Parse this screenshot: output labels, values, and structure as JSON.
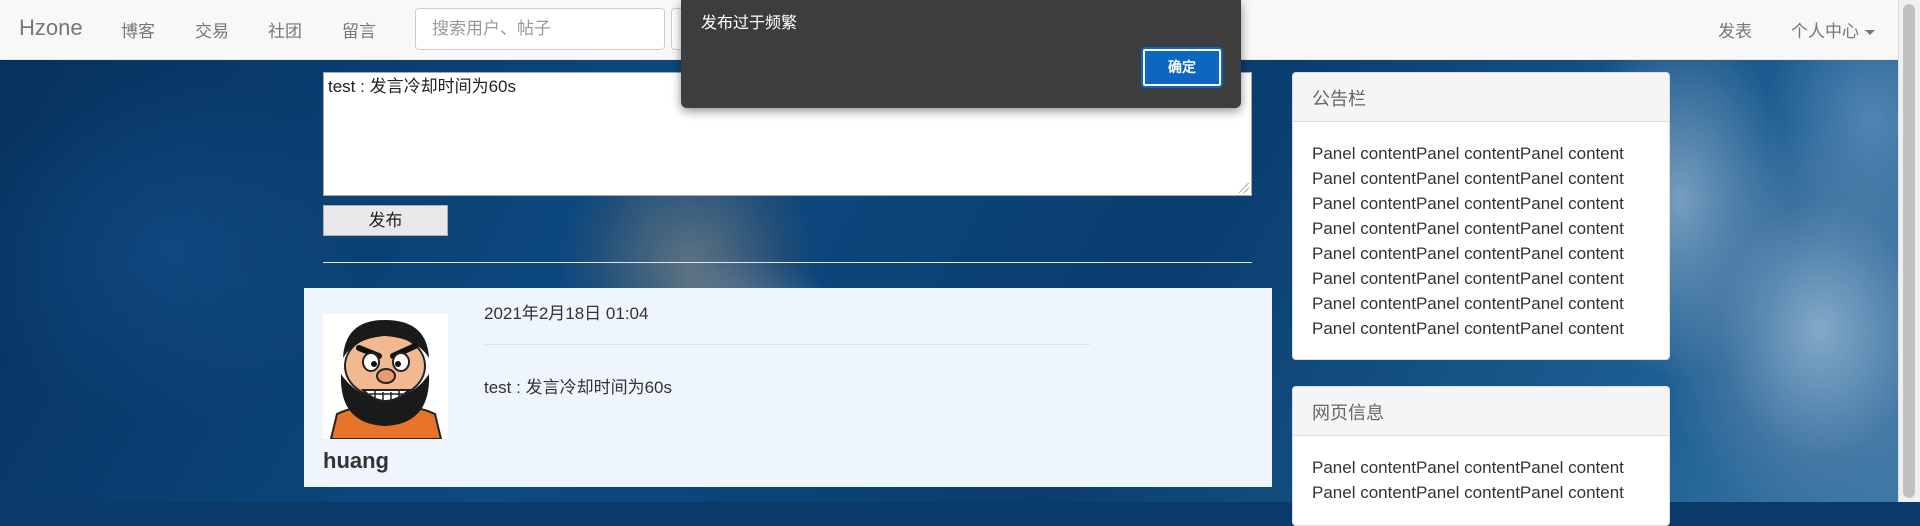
{
  "navbar": {
    "brand": "Hzone",
    "links": [
      "博客",
      "交易",
      "社团",
      "留言"
    ],
    "search_placeholder": "搜索用户、帖子",
    "right_links": {
      "post": "发表",
      "account": "个人中心"
    }
  },
  "composer": {
    "value": "test : 发言冷却时间为60s",
    "submit_label": "发布"
  },
  "post": {
    "time": "2021年2月18日 01:04",
    "text": "test : 发言冷却时间为60s",
    "username": "huang"
  },
  "panels": {
    "notice": {
      "title": "公告栏",
      "lines": [
        "Panel contentPanel contentPanel content",
        "Panel contentPanel contentPanel content",
        "Panel contentPanel contentPanel content",
        "Panel contentPanel contentPanel content",
        "Panel contentPanel contentPanel content",
        "Panel contentPanel contentPanel content",
        "Panel contentPanel contentPanel content",
        "Panel contentPanel contentPanel content"
      ]
    },
    "info": {
      "title": "网页信息",
      "lines": [
        "Panel contentPanel contentPanel content",
        "Panel contentPanel contentPanel content"
      ]
    }
  },
  "dialog": {
    "message": "发布过于频繁",
    "ok_label": "确定"
  }
}
